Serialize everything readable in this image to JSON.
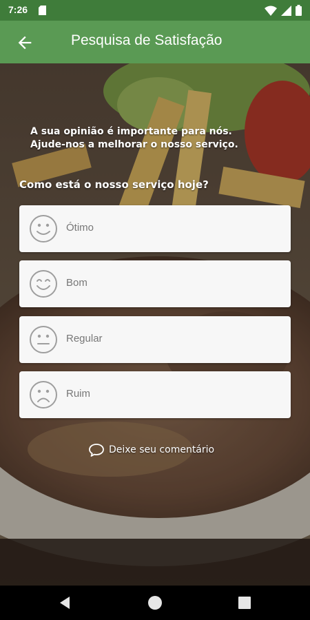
{
  "status_bar": {
    "time": "7:26"
  },
  "app_bar": {
    "title": "Pesquisa de Satisfação"
  },
  "survey": {
    "intro_line1": "A sua opinião é importante para nós.",
    "intro_line2": "Ajude-nos a melhorar o nosso serviço.",
    "question": "Como está o nosso serviço hoje?",
    "options": [
      {
        "label": "Ótimo",
        "icon": "very-happy-face-icon"
      },
      {
        "label": "Bom",
        "icon": "happy-face-icon"
      },
      {
        "label": "Regular",
        "icon": "neutral-face-icon"
      },
      {
        "label": "Ruim",
        "icon": "sad-face-icon"
      }
    ],
    "comment_label": "Deixe seu comentário"
  },
  "colors": {
    "status_bar": "#3f7c3a",
    "app_bar": "#5a9a54",
    "card": "#f7f7f7",
    "icon_gray": "#9e9e9e"
  }
}
